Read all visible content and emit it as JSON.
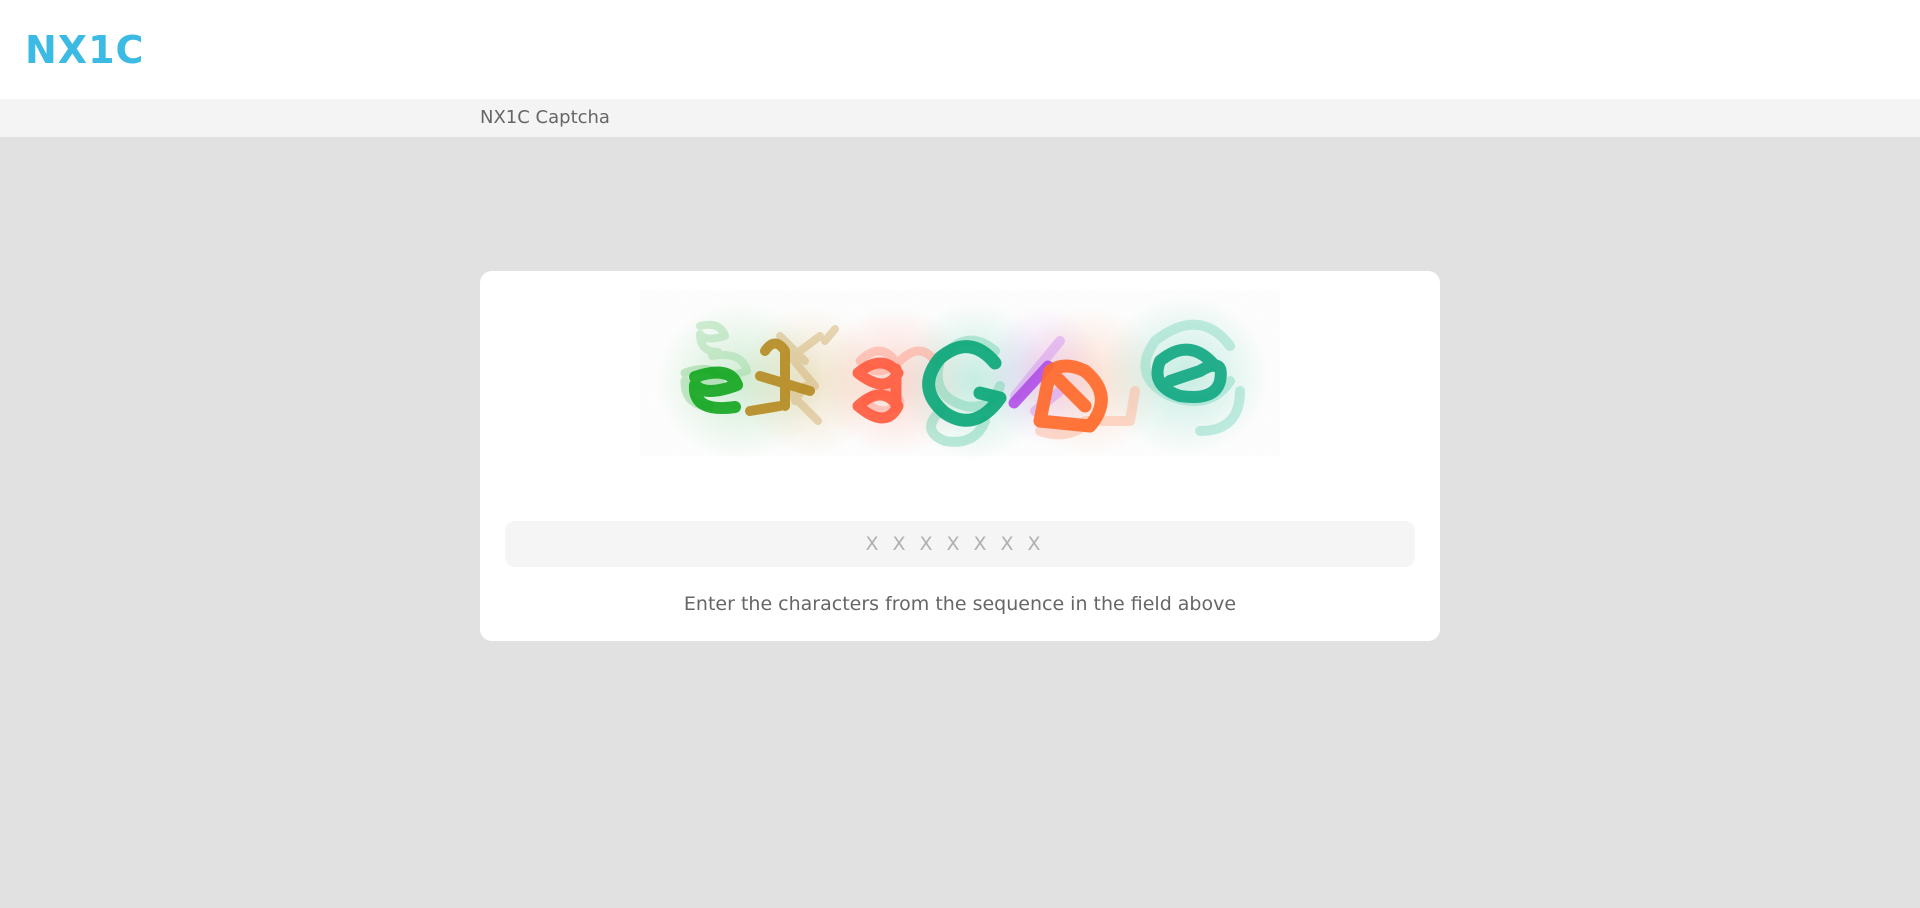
{
  "header": {
    "logo_text": "NX1C",
    "logo_color": "#3bbae4"
  },
  "subbar": {
    "title": "NX1C Captcha"
  },
  "captcha": {
    "image_alt": "captcha image",
    "glyphs": [
      {
        "char": "e",
        "color": "#12a51e"
      },
      {
        "char": "f",
        "color": "#b58a1f"
      },
      {
        "char": "a",
        "color": "#ff5a3c"
      },
      {
        "char": "G",
        "color": "#0da77a"
      },
      {
        "char": "/",
        "color": "#b04fe6"
      },
      {
        "char": "p",
        "color": "#ff6a2a"
      },
      {
        "char": "G",
        "color": "#14a882"
      }
    ]
  },
  "form": {
    "code_value": "",
    "code_placeholder": "XXXXXXX",
    "hint": "Enter the characters from the sequence in the field above"
  }
}
